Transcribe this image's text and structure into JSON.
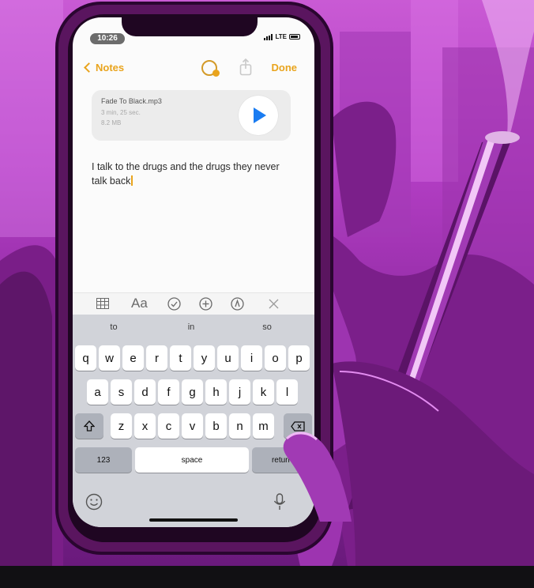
{
  "status": {
    "time": "10:26",
    "network": "LTE"
  },
  "nav": {
    "back_label": "Notes",
    "done_label": "Done",
    "collab_icon": "collaborate-icon",
    "share_icon": "share-icon",
    "back_icon": "chevron-left-icon"
  },
  "attachment": {
    "name": "Fade To Black.mp3",
    "duration": "3 min, 25 sec.",
    "size": "8.2 MB",
    "play_icon": "play-icon"
  },
  "note": {
    "text": "I talk to the drugs and the drugs they never talk back"
  },
  "toolbar": {
    "icons": [
      "table-icon",
      "format-text-icon",
      "checklist-icon",
      "add-icon",
      "markup-icon",
      "close-icon"
    ],
    "format_label": "Aa"
  },
  "keyboard": {
    "suggestions": [
      "to",
      "in",
      "so"
    ],
    "row1": [
      "q",
      "w",
      "e",
      "r",
      "t",
      "y",
      "u",
      "i",
      "o",
      "p"
    ],
    "row2": [
      "a",
      "s",
      "d",
      "f",
      "g",
      "h",
      "j",
      "k",
      "l"
    ],
    "row3": [
      "z",
      "x",
      "c",
      "v",
      "b",
      "n",
      "m"
    ],
    "numbers_label": "123",
    "space_label": "space",
    "return_label": "return",
    "emoji_icon": "emoji-icon",
    "mic_icon": "microphone-icon"
  },
  "colors": {
    "accent": "#e9a41d",
    "play": "#1a7cf1",
    "art_magenta": "#c95ad4",
    "art_dark": "#5a155f"
  }
}
